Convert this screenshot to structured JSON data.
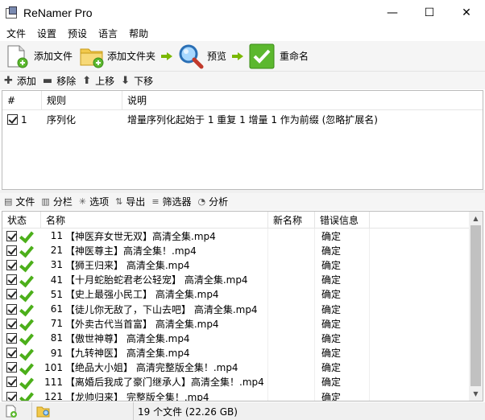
{
  "window": {
    "title": "ReNamer Pro",
    "minimize": "—",
    "maximize": "☐",
    "close": "✕"
  },
  "menu": [
    "文件",
    "设置",
    "预设",
    "语言",
    "帮助"
  ],
  "toolbar": {
    "add_files": "添加文件",
    "add_folders": "添加文件夹",
    "preview": "预览",
    "rename": "重命名"
  },
  "rules_toolbar": {
    "add": "添加",
    "remove": "移除",
    "up": "上移",
    "down": "下移"
  },
  "rules_table": {
    "headers": [
      "#",
      "规则",
      "说明"
    ],
    "rows": [
      {
        "num": "1",
        "rule": "序列化",
        "desc": "增量序列化起始于 1 重复 1 增量 1 作为前缀 (忽略扩展名)"
      }
    ]
  },
  "files_toolbar": {
    "files": "文件",
    "columns": "分栏",
    "options": "选项",
    "export": "导出",
    "filters": "筛选器",
    "analyze": "分析"
  },
  "files_table": {
    "headers": [
      "状态",
      "名称",
      "新名称",
      "错误信息"
    ],
    "rows": [
      {
        "num": "11",
        "name": "【神医弃女世无双】高清全集.mp4",
        "status": "确定"
      },
      {
        "num": "21",
        "name": "【神医尊主】高清全集！.mp4",
        "status": "确定"
      },
      {
        "num": "31",
        "name": "【狮王归来】 高清全集.mp4",
        "status": "确定"
      },
      {
        "num": "41",
        "name": "【十月蛇胎蛇君老公轻宠】 高清全集.mp4",
        "status": "确定"
      },
      {
        "num": "51",
        "name": "【史上最强小民工】 高清全集.mp4",
        "status": "确定"
      },
      {
        "num": "61",
        "name": "【徒儿你无敌了，下山去吧】 高清全集.mp4",
        "status": "确定"
      },
      {
        "num": "71",
        "name": "【外卖古代当首富】 高清全集.mp4",
        "status": "确定"
      },
      {
        "num": "81",
        "name": "【傲世神尊】 高清全集.mp4",
        "status": "确定"
      },
      {
        "num": "91",
        "name": "【九转神医】 高清全集.mp4",
        "status": "确定"
      },
      {
        "num": "101",
        "name": "【绝品大小姐】 高清完整版全集！.mp4",
        "status": "确定"
      },
      {
        "num": "111",
        "name": "【离婚后我成了豪门继承人】高清全集！.mp4",
        "status": "确定"
      },
      {
        "num": "121",
        "name": "【龙帅归来】 完整版全集！.mp4",
        "status": "确定"
      }
    ]
  },
  "statusbar": {
    "summary": "19 个文件 (22.26 GB)"
  },
  "colors": {
    "accent_green": "#4caf1a",
    "toolbar_bg": "#f5f5f5"
  }
}
